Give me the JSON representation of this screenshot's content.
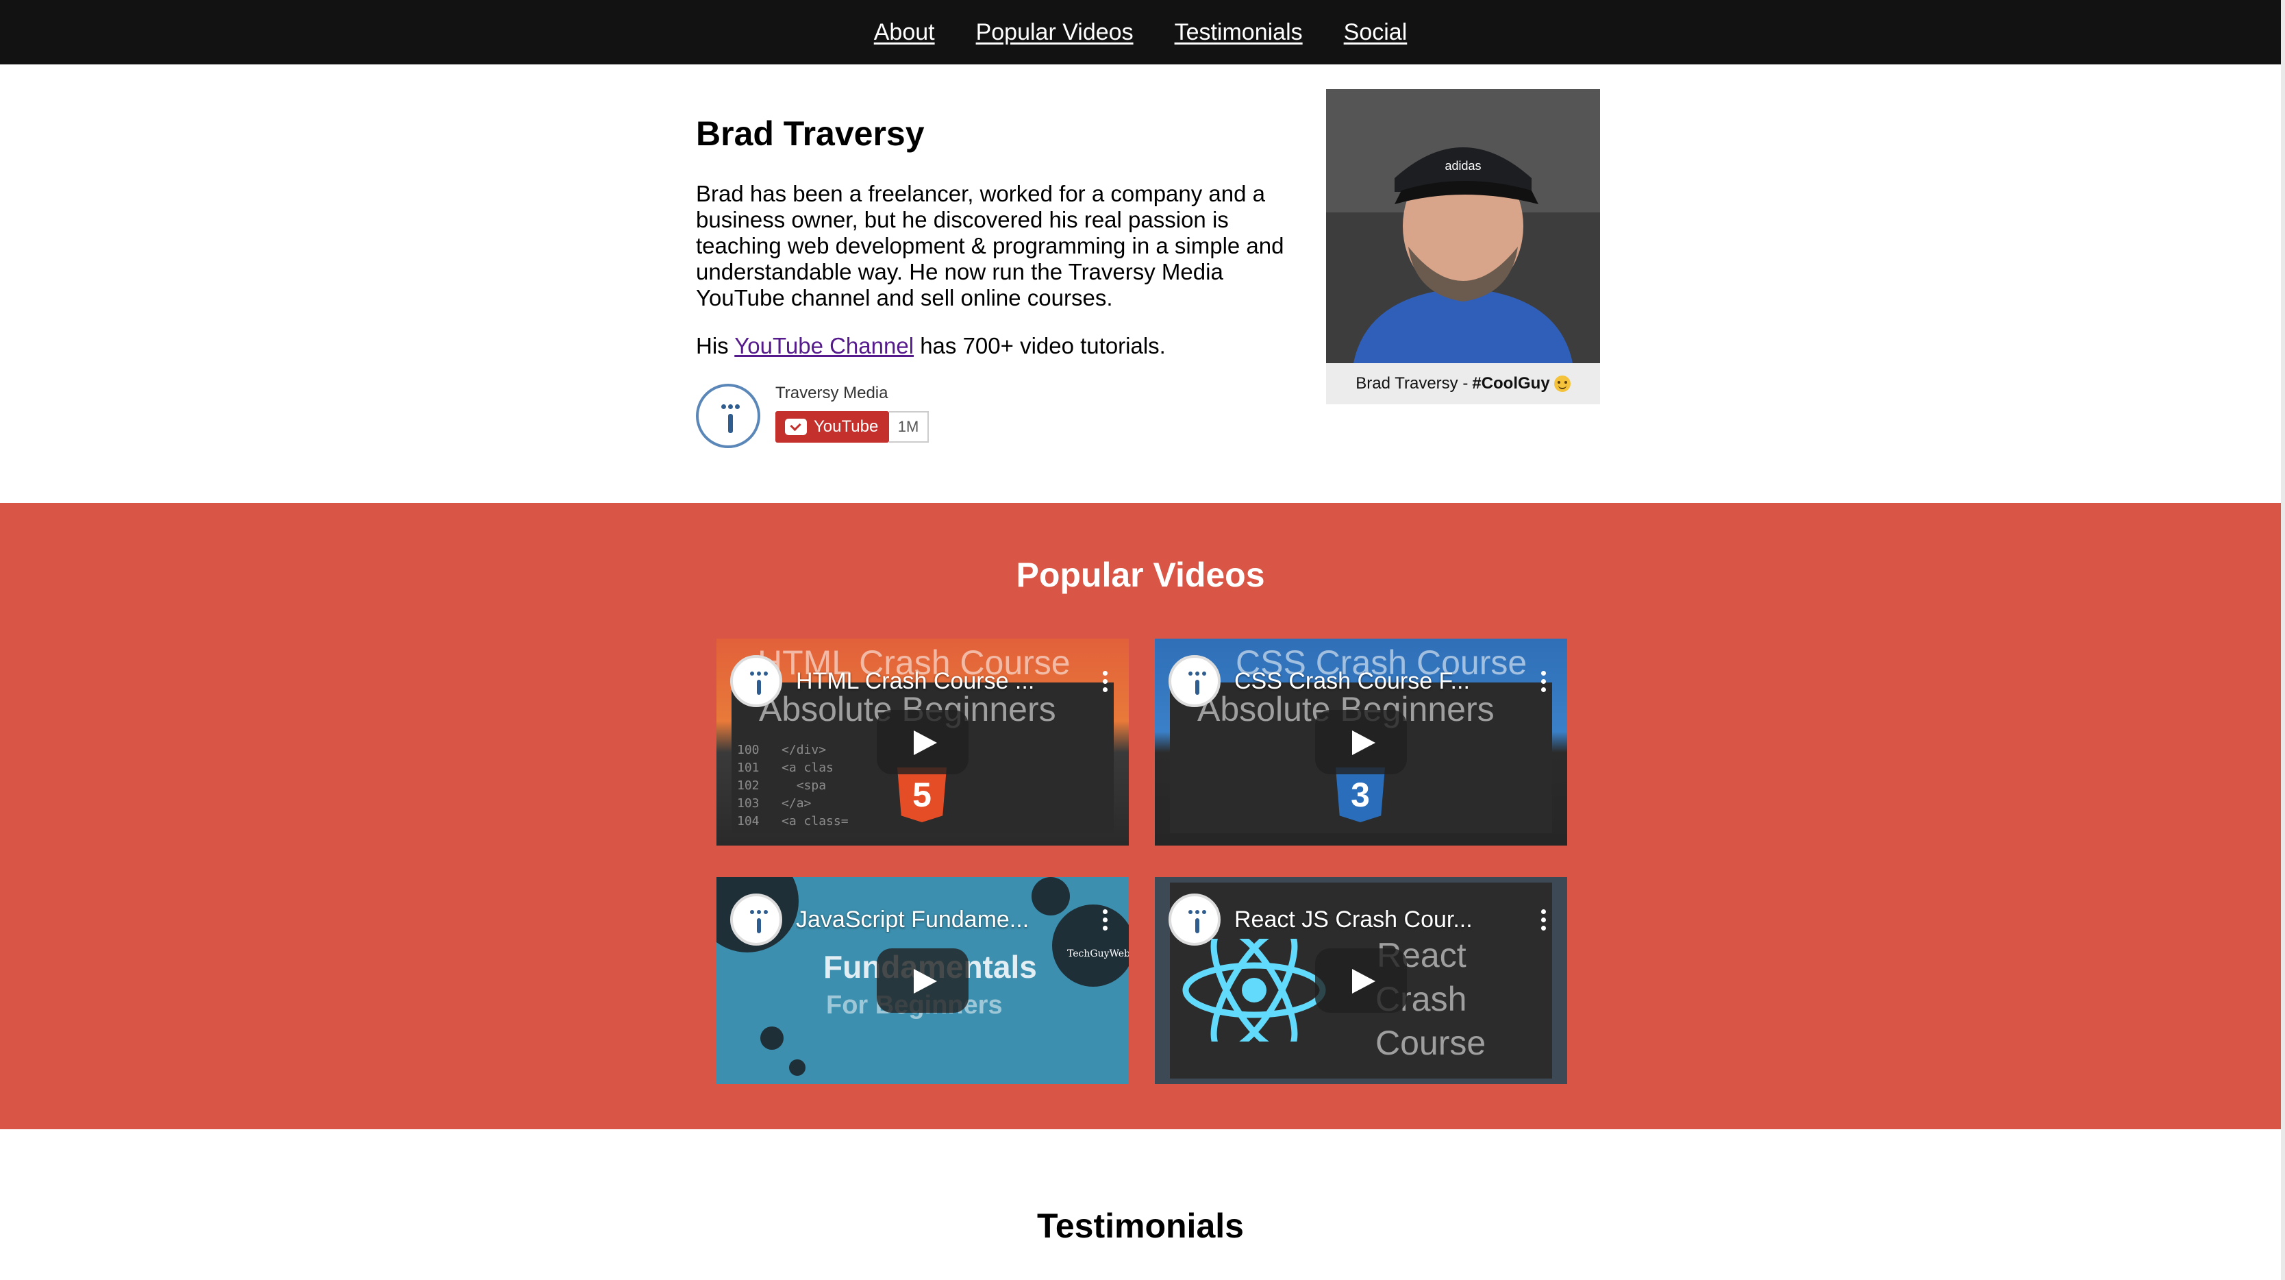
{
  "nav": {
    "items": [
      "About",
      "Popular Videos",
      "Testimonials",
      "Social"
    ]
  },
  "about": {
    "name": "Brad Traversy",
    "bio": "Brad has been a freelancer, worked for a company and a business owner, but he discovered his real passion is teaching web development & programming in a simple and understandable way. He now run the Traversy Media YouTube channel and sell online courses.",
    "channel_prefix": "His",
    "channel_link": "YouTube Channel",
    "channel_suffix": "has 700+ video tutorials.",
    "subscribe": {
      "channel_name": "Traversy Media",
      "button_label": "YouTube",
      "count": "1M"
    },
    "photo_caption_prefix": "Brad Traversy -",
    "photo_caption_bold": "#CoolGuy"
  },
  "videos": {
    "title": "Popular Videos",
    "items": [
      {
        "title": "HTML Crash Course ...",
        "thumb_text_1": "HTML Crash Course",
        "thumb_text_2": "Absolute Beginners",
        "badge": "5"
      },
      {
        "title": "CSS Crash Course F...",
        "thumb_text_1": "CSS Crash Course",
        "thumb_text_2": "Absolute Beginners",
        "badge": "3"
      },
      {
        "title": "JavaScript Fundame...",
        "thumb_text_1": "Fundamentals",
        "thumb_text_2": "For Beginners",
        "thumb_tag": "TechGuyWeb"
      },
      {
        "title": "React JS Crash Cour...",
        "thumb_text_1": "React",
        "thumb_text_2": "Crash Course"
      }
    ]
  },
  "testimonials": {
    "title": "Testimonials"
  },
  "colors": {
    "nav_bg": "#121212",
    "videos_bg": "#d95646",
    "link_visited": "#551a8b",
    "youtube_red": "#c4302b"
  }
}
